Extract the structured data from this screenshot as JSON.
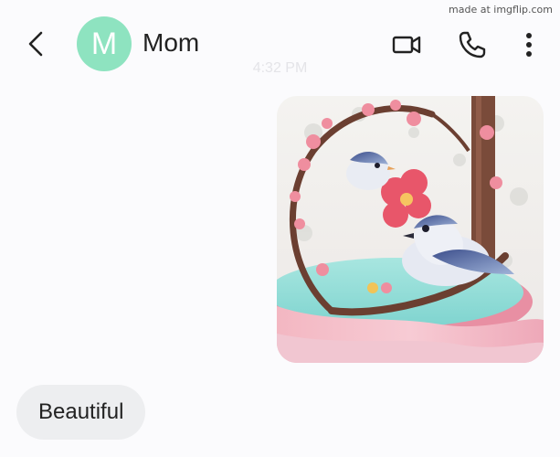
{
  "watermark": "made at imgflip.com",
  "header": {
    "back_icon": "chevron-left-icon",
    "avatar_letter": "M",
    "avatar_color": "#8ee3c0",
    "contact_name": "Mom",
    "actions": [
      "video-camera-icon",
      "phone-icon",
      "more-vertical-icon"
    ]
  },
  "conversation": {
    "timestamp": "4:32 PM",
    "sent_image": {
      "description_icon": "image-attachment",
      "subject": "birds on cherry blossom branch"
    },
    "received_messages": [
      {
        "text": "Beautiful"
      }
    ]
  },
  "colors": {
    "background": "#fbfbfd",
    "bubble": "#edeef0"
  }
}
